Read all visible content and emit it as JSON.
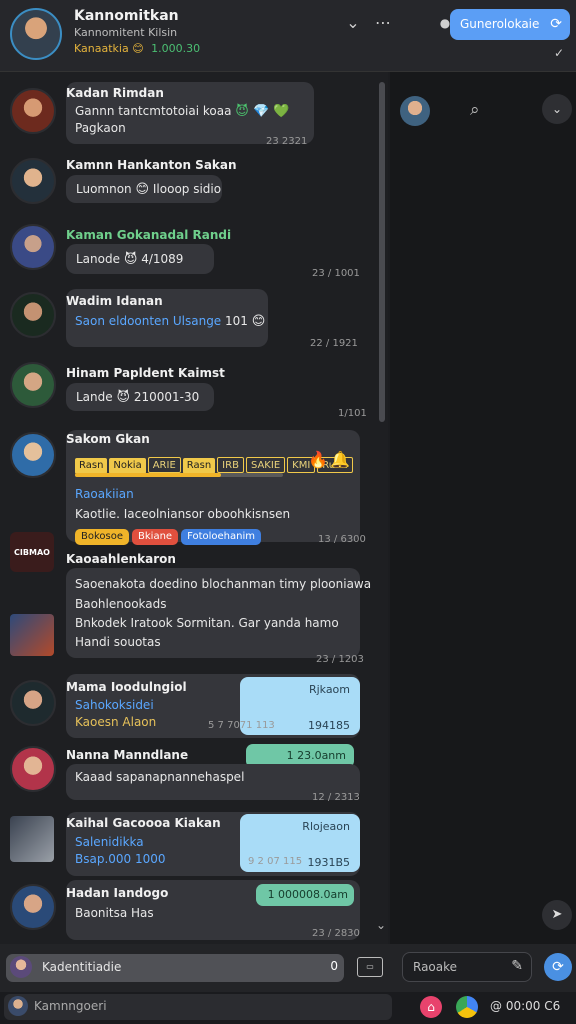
{
  "header": {
    "title": "Kannomitkan",
    "subtitle": "Kannomitent Kilsin",
    "status_label": "Kanaatkia",
    "status_emoji": "😊",
    "status_number": "1.000.30",
    "primary_button": "Gunerolokaie"
  },
  "messages": [
    {
      "name": "Kadan Rimdan",
      "text": "Gannn tantcmtotoiai koaa",
      "emojis": "😈 💎 💚",
      "link": "Pagkaon",
      "time": "23 2321"
    },
    {
      "name": "Kamnn Hankanton Sakan",
      "text": "Luomnon",
      "emojis": "😊",
      "tail": "Ilooop sidio"
    },
    {
      "name": "Kaman Gokanadal Randi",
      "text": "Lanode",
      "emojis": "😈",
      "tail": "4/1089",
      "time": "23 / 1001"
    },
    {
      "name": "Wadim Idanan",
      "text": "Saon eldoonten Ulsange",
      "tail": "101",
      "emojis": "😊",
      "time": "22 / 1921"
    },
    {
      "name": "Hinam Papldent Kaimst",
      "text": "Lande",
      "emojis": "😈",
      "tail": "210001-30",
      "time": "1/101"
    },
    {
      "name": "Sakom Gkan",
      "stats": [
        "Rasn",
        "Nokia",
        "ARIE",
        "Rasn",
        "IRB",
        "SAKIE",
        "KMI",
        "Ruan"
      ],
      "progress": 0.7,
      "link": "Raoakiian",
      "line2": "Kaotlie. Iaceolniansor oboohkisnsen",
      "tags": [
        "Bokosoe",
        "Bkiane",
        "Fotoloehanim"
      ],
      "time": "13 / 6300"
    },
    {
      "name": "Kaoaahlenkaron",
      "badge": "CIBMAO",
      "lines": [
        "Saoenakota doedino blochanman timy plooniawa",
        "Baohlenookads",
        "Bnkodek Iratook Sormitan. Gar yanda hamo",
        "Handi souotas"
      ],
      "time": "23 / 1203"
    },
    {
      "name": "Mama Ioodulngiol",
      "line1": "Sahokoksidei",
      "line2": "Kaoesn Alaon",
      "card_title": "Rjkaom",
      "card_num": "194185",
      "time": "5 7 7071 113"
    },
    {
      "name": "Nanna Manndlane",
      "line1": "Kaaad sapanapnannehaspel",
      "card_title": "1 23.0anm",
      "time": "12 / 2313"
    },
    {
      "name": "Kaihal Gacoooa Kiakan",
      "line1": "Salenidikka",
      "line2": "Bsap.000 1000",
      "card_title": "Rlojeaon",
      "card_num": "1931B5",
      "time": "9 2 07 115"
    },
    {
      "name": "Hadan Iandogo",
      "line1": "Baonitsa Has",
      "card_title": "1 000008.0am",
      "time": "23 / 2830"
    }
  ],
  "composer": {
    "placeholder": "Kadentitiadie",
    "count": "0",
    "search_placeholder": "Raoake"
  },
  "bottom": {
    "input_placeholder": "Kamnngoeri",
    "status": "@ 00:00 C6"
  }
}
